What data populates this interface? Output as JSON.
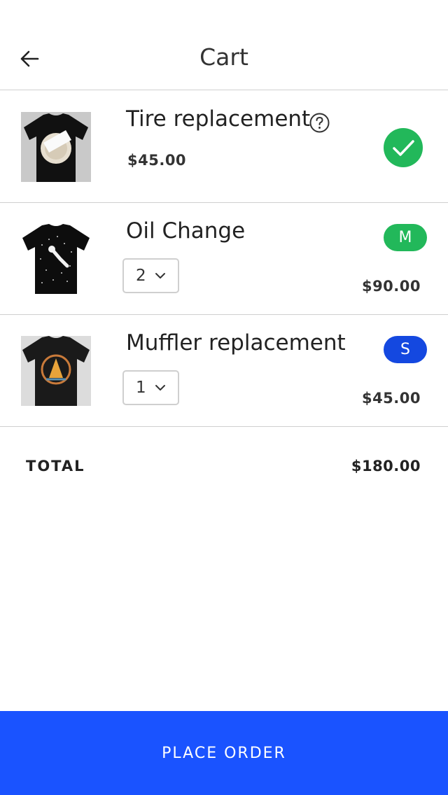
{
  "header": {
    "title": "Cart"
  },
  "items": [
    {
      "name": "Tire replacement",
      "price": "$45.00"
    },
    {
      "name": "Oil Change",
      "quantity": "2",
      "size": "M",
      "price": "$90.00"
    },
    {
      "name": "Muffler replacement",
      "quantity": "1",
      "size": "S",
      "price": "$45.00"
    }
  ],
  "summary": {
    "total_label": "TOTAL",
    "total_value": "$180.00"
  },
  "actions": {
    "place_order_label": "PLACE ORDER"
  },
  "icons": {
    "back": "arrow-left-icon",
    "help": "question-circle-icon",
    "selected": "check-circle-icon",
    "dropdown": "chevron-down-icon"
  },
  "colors": {
    "primary_blue": "#1a53ff",
    "green": "#22b85a",
    "badge_blue": "#1448e0",
    "divider": "#cfcfcf"
  }
}
